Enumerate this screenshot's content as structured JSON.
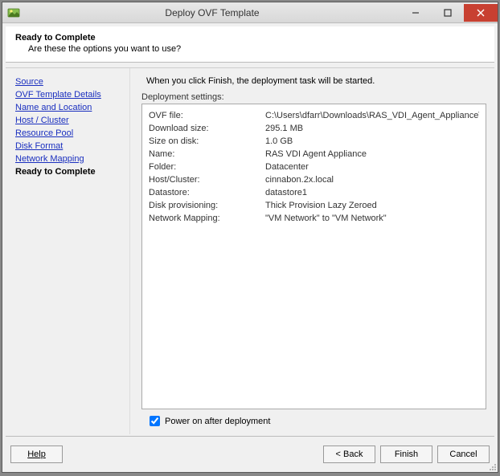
{
  "window": {
    "title": "Deploy OVF Template"
  },
  "header": {
    "title": "Ready to Complete",
    "subtitle": "Are these the options you want to use?"
  },
  "nav": {
    "items": [
      "Source",
      "OVF Template Details",
      "Name and Location",
      "Host / Cluster",
      "Resource Pool",
      "Disk Format",
      "Network Mapping"
    ],
    "current": "Ready to Complete"
  },
  "main": {
    "intro": "When you click Finish, the deployment task will be started.",
    "settings_label": "Deployment settings:",
    "rows": [
      {
        "key": "OVF file:",
        "val": "C:\\Users\\dfarr\\Downloads\\RAS_VDI_Agent_Appliance\\RAS..."
      },
      {
        "key": "Download size:",
        "val": "295.1 MB"
      },
      {
        "key": "Size on disk:",
        "val": "1.0 GB"
      },
      {
        "key": "Name:",
        "val": "RAS VDI Agent Appliance"
      },
      {
        "key": "Folder:",
        "val": "Datacenter"
      },
      {
        "key": "Host/Cluster:",
        "val": "cinnabon.2x.local"
      },
      {
        "key": "Datastore:",
        "val": "datastore1"
      },
      {
        "key": "Disk provisioning:",
        "val": "Thick Provision Lazy Zeroed"
      },
      {
        "key": "Network Mapping:",
        "val": "\"VM Network\" to \"VM Network\""
      }
    ],
    "checkbox_label": "Power on after deployment",
    "checkbox_checked": true
  },
  "footer": {
    "help": "Help",
    "back": "< Back",
    "finish": "Finish",
    "cancel": "Cancel"
  }
}
